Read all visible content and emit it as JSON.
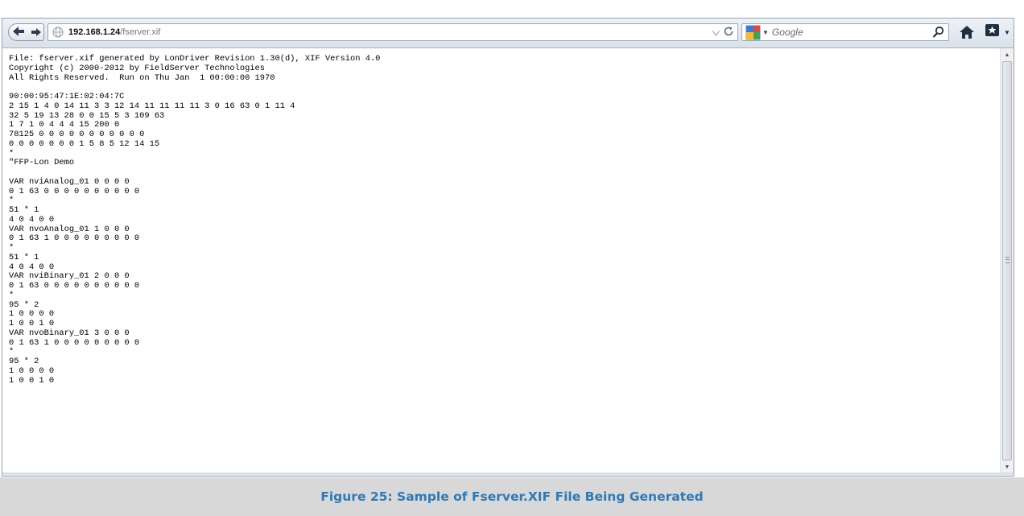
{
  "browser": {
    "url_host": "192.168.1.24",
    "url_path": "/fserver.xif",
    "url_dropdown_icon": "dropdown-arrow-icon",
    "reload_icon": "reload-icon",
    "search_engine_icon": "google-icon",
    "search_placeholder": "Google",
    "search_button_icon": "magnifier-icon",
    "home_icon": "home-icon",
    "bookmarks_icon": "bookmarks-icon"
  },
  "file_content": "File: fserver.xif generated by LonDriver Revision 1.30(d), XIF Version 4.0\nCopyright (c) 2000-2012 by FieldServer Technologies\nAll Rights Reserved.  Run on Thu Jan  1 00:00:00 1970\n\n90:00:95:47:1E:02:04:7C\n2 15 1 4 0 14 11 3 3 12 14 11 11 11 11 3 0 16 63 0 1 11 4\n32 5 19 13 28 0 0 15 5 3 109 63\n1 7 1 0 4 4 4 15 200 0\n78125 0 0 0 0 0 0 0 0 0 0 0\n0 0 0 0 0 0 0 1 5 8 5 12 14 15\n*\n\"FFP-Lon Demo\n\nVAR nviAnalog_01 0 0 0 0\n0 1 63 0 0 0 0 0 0 0 0 0 0\n*\n51 * 1\n4 0 4 0 0\nVAR nvoAnalog_01 1 0 0 0\n0 1 63 1 0 0 0 0 0 0 0 0 0\n*\n51 * 1\n4 0 4 0 0\nVAR nviBinary_01 2 0 0 0\n0 1 63 0 0 0 0 0 0 0 0 0 0\n*\n95 * 2\n1 0 0 0 0\n1 0 0 1 0\nVAR nvoBinary_01 3 0 0 0\n0 1 63 1 0 0 0 0 0 0 0 0 0\n*\n95 * 2\n1 0 0 0 0\n1 0 0 1 0",
  "caption": "Figure 25: Sample of Fserver.XIF File Being Generated",
  "colors": {
    "caption_text": "#2e7ab8",
    "caption_band": "#d8d8d8"
  }
}
